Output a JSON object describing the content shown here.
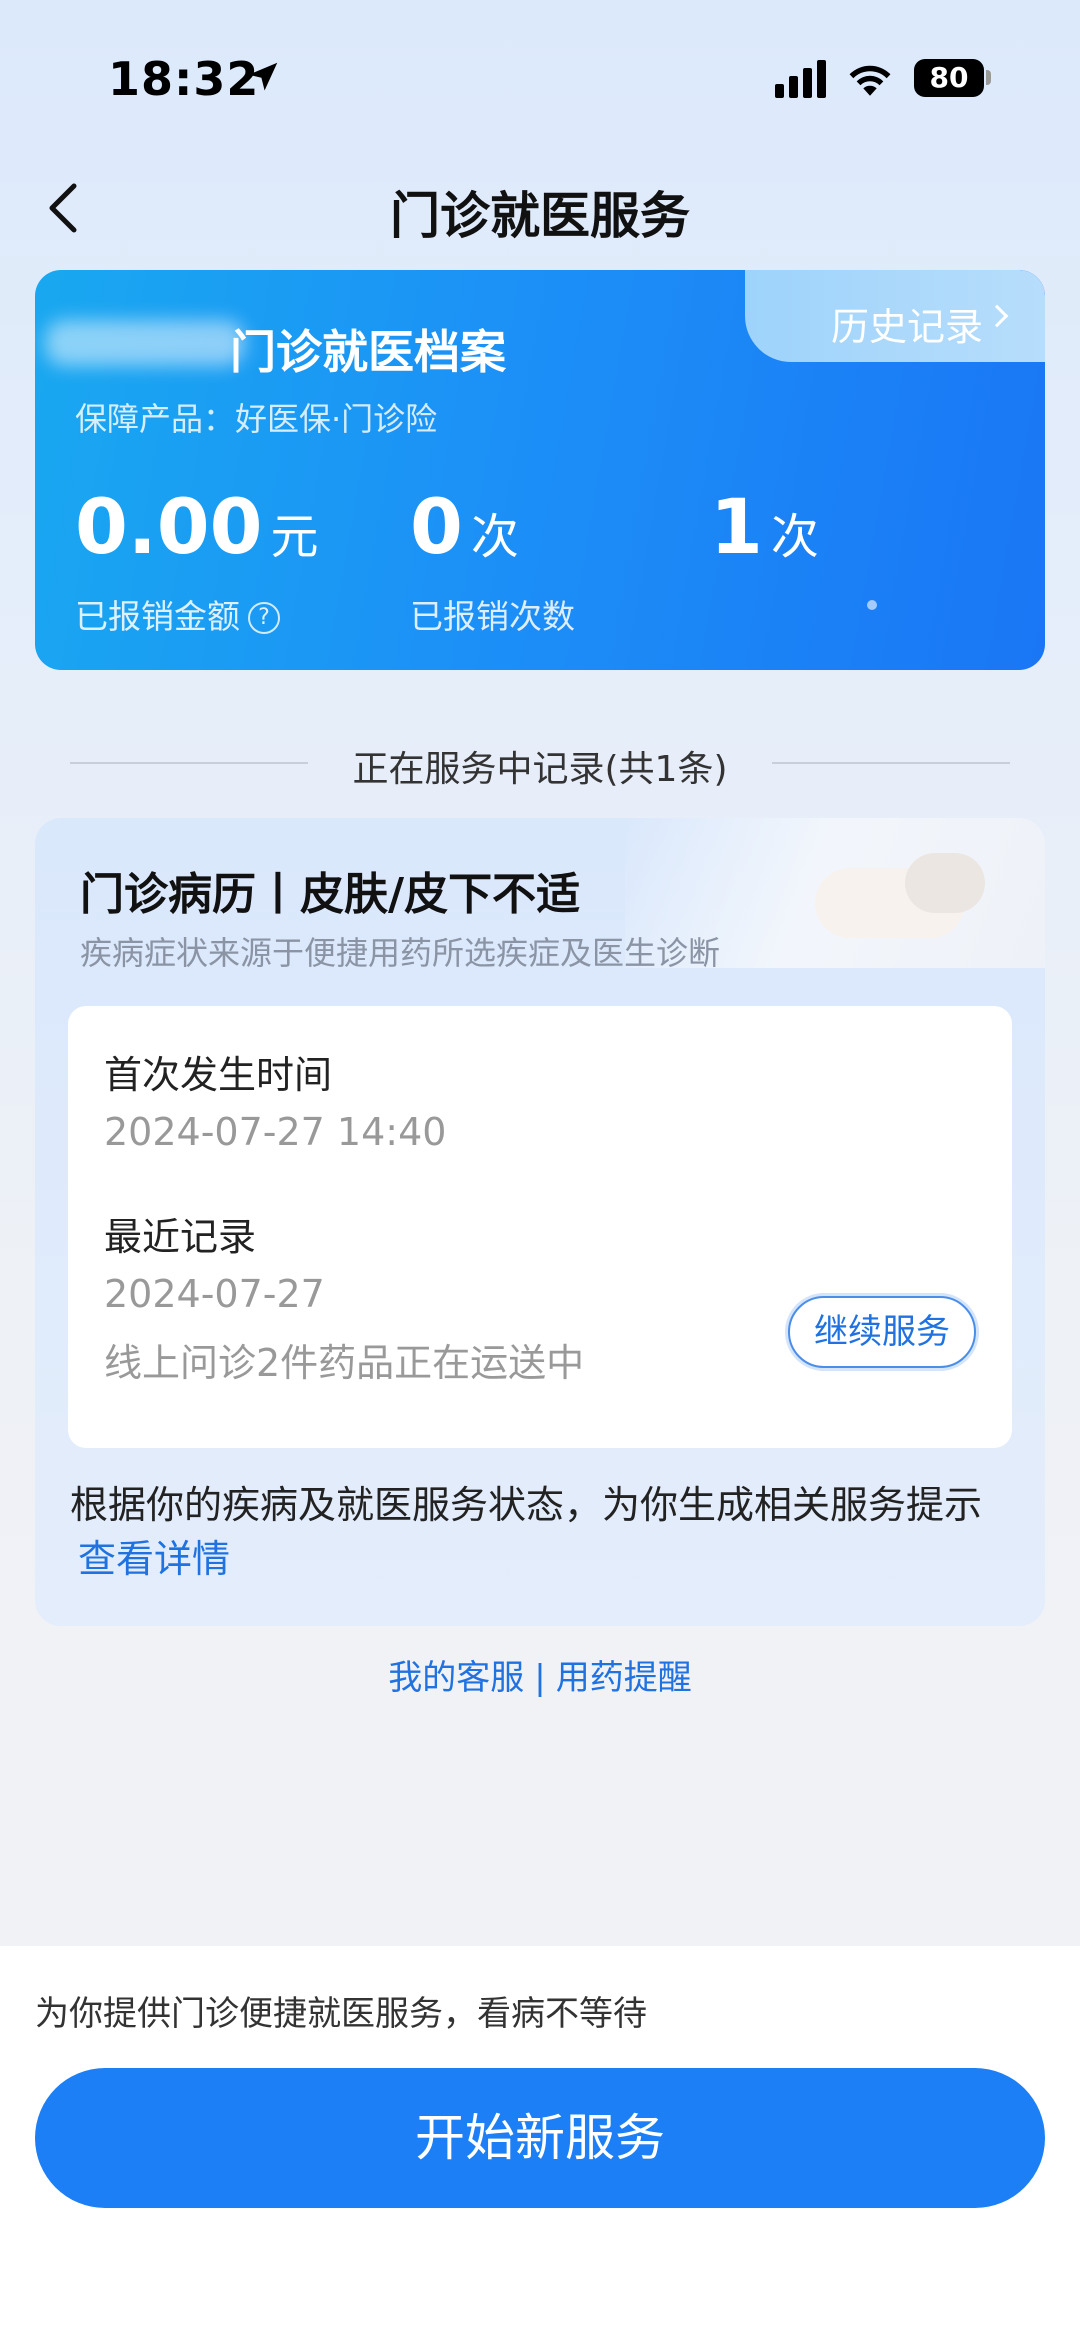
{
  "status_bar": {
    "time": "18:32",
    "battery": "80"
  },
  "nav": {
    "title": "门诊就医服务"
  },
  "summary": {
    "history_label": "历史记录",
    "title": "门诊就医档案",
    "product": "保障产品：好医保·门诊险",
    "stats": [
      {
        "value": "0.00",
        "unit": "元",
        "label": "已报销金额"
      },
      {
        "value": "0",
        "unit": "次",
        "label": "已报销次数"
      },
      {
        "value": "1",
        "unit": "次",
        "label": ""
      }
    ],
    "help_glyph": "?"
  },
  "section": {
    "title": "正在服务中记录(共1条)"
  },
  "record": {
    "title": "门诊病历丨皮肤/皮下不适",
    "subtitle": "疾病症状来源于便捷用药所选疾症及医生诊断",
    "first_label": "首次发生时间",
    "first_value": "2024-07-27 14:40",
    "recent_label": "最近记录",
    "recent_date": "2024-07-27",
    "recent_desc": "线上问诊2件药品正在运送中",
    "continue_label": "继续服务",
    "tip": "根据你的疾病及就医服务状态，为你生成相关服务提示",
    "tip_link": "查看详情"
  },
  "links": {
    "service": "我的客服",
    "separator": "|",
    "reminder": "用药提醒"
  },
  "footer": {
    "text": "为你提供门诊便捷就医服务，看病不等待",
    "button": "开始新服务"
  }
}
